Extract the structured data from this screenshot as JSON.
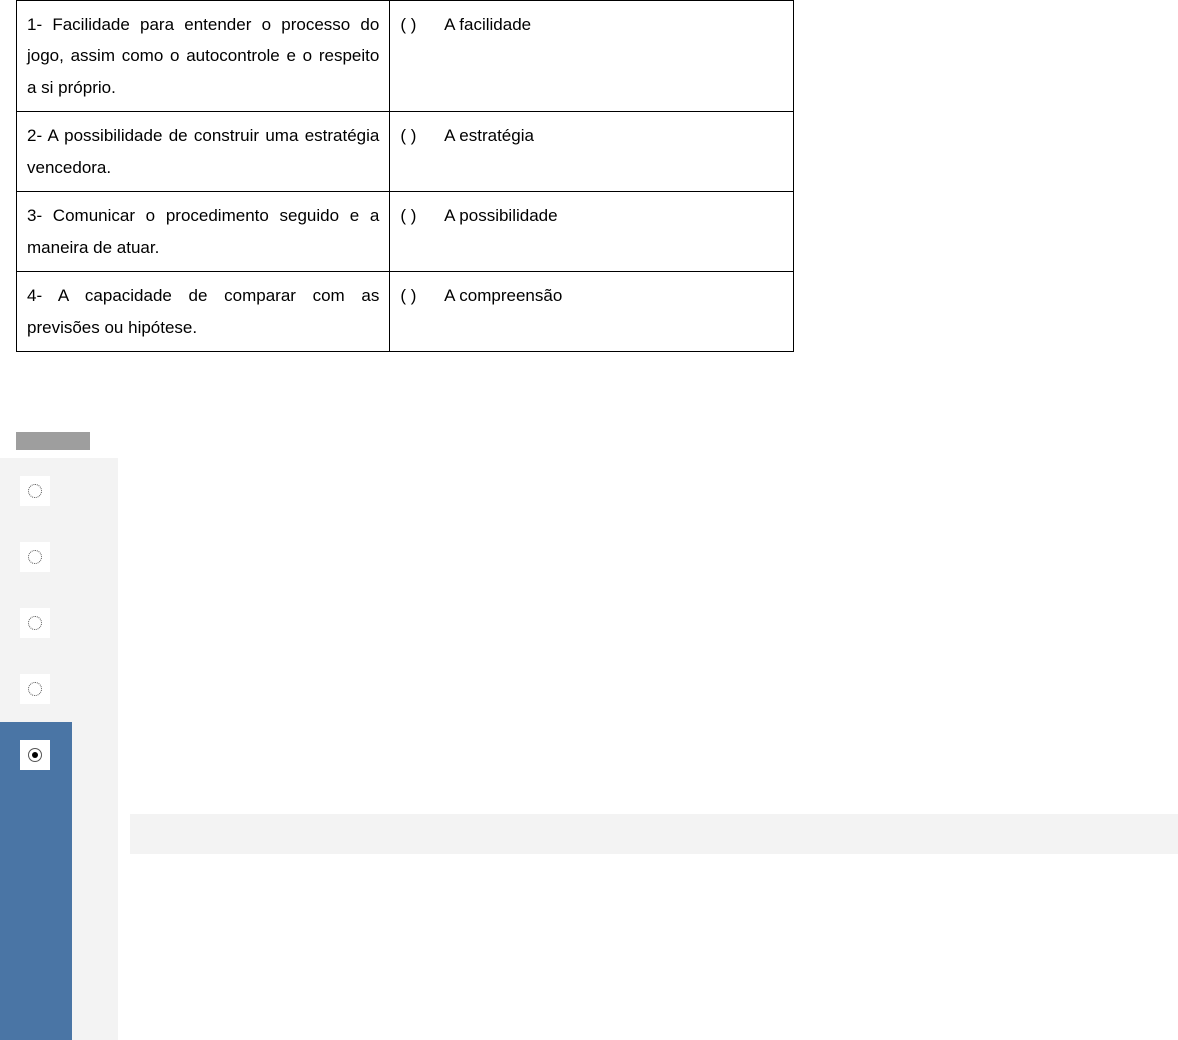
{
  "table": {
    "rows": [
      {
        "left": "1- Facilidade para entender o processo do jogo, assim como o autocontrole e o respeito a si próprio.",
        "right_paren": "(   )",
        "right_label": "A facilidade"
      },
      {
        "left": "2- A possibilidade de construir uma estratégia vencedora.",
        "right_paren": "(   )",
        "right_label": "A estratégia"
      },
      {
        "left": "3- Comunicar o procedimento seguido e a maneira de atuar.",
        "right_paren": "(   )",
        "right_label": "A possibilidade"
      },
      {
        "left": "4- A capacidade de comparar com as previsões ou hipótese.",
        "right_paren": "(   )",
        "right_label": "A compreensão"
      }
    ]
  },
  "options": {
    "items": [
      {
        "selected": false
      },
      {
        "selected": false
      },
      {
        "selected": false
      },
      {
        "selected": false
      },
      {
        "selected": true
      }
    ]
  }
}
